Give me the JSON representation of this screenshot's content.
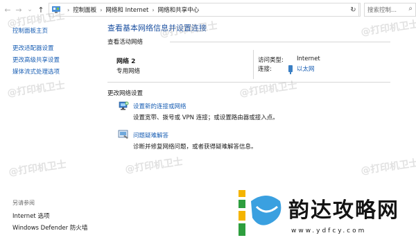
{
  "nav": {
    "back": "←",
    "forward": "→",
    "recent": "⌄",
    "up": "↑"
  },
  "address": {
    "crumbs": [
      "控制面板",
      "网络和 Internet",
      "网络和共享中心"
    ],
    "refresh": "↻",
    "search_placeholder": "搜索控制..."
  },
  "sidebar": {
    "home": "控制面板主页",
    "items": [
      "更改适配器设置",
      "更改高级共享设置",
      "媒体流式处理选项"
    ],
    "see_also_label": "另请参阅",
    "see_also": [
      "Internet 选项",
      "Windows Defender 防火墙"
    ]
  },
  "main": {
    "title": "查看基本网络信息并设置连接",
    "active_label": "查看活动网络",
    "network": {
      "name": "网络 2",
      "type": "专用网络",
      "access_key": "访问类型:",
      "access_value": "Internet",
      "conn_key": "连接:",
      "conn_value": "以太网"
    },
    "change_label": "更改网络设置",
    "actions": [
      {
        "link": "设置新的连接或网络",
        "desc": "设置宽带、拨号或 VPN 连接；或设置路由器或接入点。"
      },
      {
        "link": "问题疑难解答",
        "desc": "诊断并修复网络问题，或者获得疑难解答信息。"
      }
    ]
  },
  "watermark": "@打印机卫士",
  "logo": {
    "text": "韵达攻略网",
    "url": "www.ydfcy.com"
  },
  "colors": {
    "link": "#1a5fb4",
    "title": "#1a4fa0",
    "rule": "#d6d6d6"
  }
}
